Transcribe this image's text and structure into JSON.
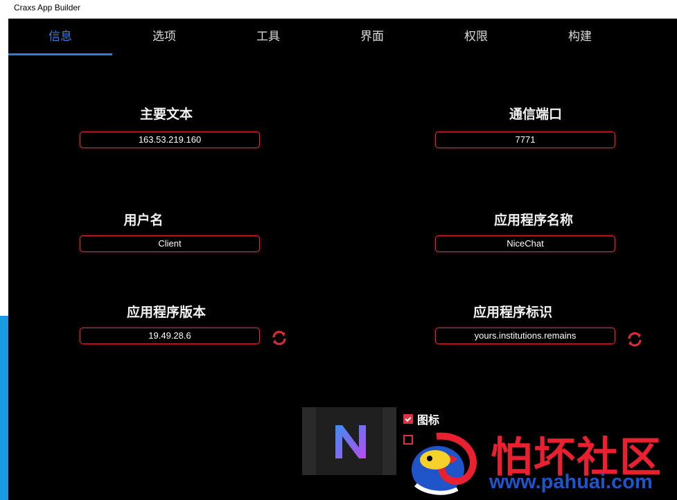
{
  "window": {
    "title": "Craxs App Builder"
  },
  "tabs": [
    {
      "label": "信息"
    },
    {
      "label": "选项"
    },
    {
      "label": "工具"
    },
    {
      "label": "界面"
    },
    {
      "label": "权限"
    },
    {
      "label": "构建"
    }
  ],
  "active_tab": 0,
  "fields": {
    "host": {
      "label": "主要文本",
      "value": "163.53.219.160"
    },
    "port": {
      "label": "通信端口",
      "value": "7771"
    },
    "username": {
      "label": "用户名",
      "value": "Client"
    },
    "app_name": {
      "label": "应用程序名称",
      "value": "NiceChat"
    },
    "app_version": {
      "label": "应用程序版本",
      "value": "19.49.28.6"
    },
    "app_id": {
      "label": "应用程序标识",
      "value": "yours.institutions.remains"
    }
  },
  "icon_options": {
    "icon_checkbox": {
      "label": "图标",
      "checked": true
    },
    "second_checkbox": {
      "label": "",
      "checked": false
    }
  },
  "watermark": {
    "text": "怕坏社区",
    "url": "www.pahuai.com"
  },
  "colors": {
    "accent_blue": "#2f7ed8",
    "border_red": "#e0293b",
    "background": "#000000"
  }
}
